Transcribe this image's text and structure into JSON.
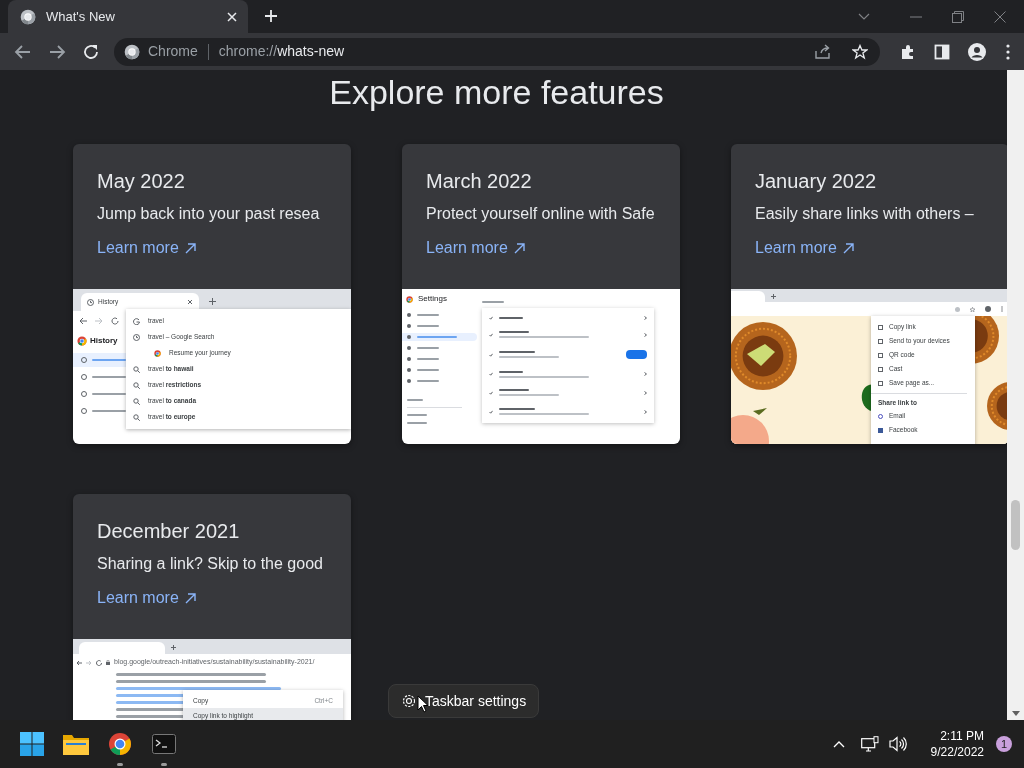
{
  "browser": {
    "tab": {
      "title": "What's New",
      "selected": true
    },
    "address": {
      "origin": "Chrome",
      "url_prefix": "chrome://",
      "url_path": "whats-new"
    }
  },
  "page": {
    "heading": "Explore more features",
    "cards": [
      {
        "month": "May 2022",
        "description": "Jump back into your past resea",
        "link": "Learn more",
        "thumbnail": {
          "kind": "history",
          "tab_title": "History",
          "page_title": "History",
          "suggestions": [
            {
              "kind": "google",
              "text": "travel"
            },
            {
              "kind": "history",
              "text": "travel – Google Search"
            },
            {
              "kind": "journey",
              "text": "Resume your journey"
            },
            {
              "kind": "search",
              "text": "travel **to hawaii**"
            },
            {
              "kind": "search",
              "text": "travel **restrictions**"
            },
            {
              "kind": "search",
              "text": "travel **to canada**"
            },
            {
              "kind": "search",
              "text": "travel **to europe**"
            }
          ]
        }
      },
      {
        "month": "March 2022",
        "description": "Protect yourself online with Safe",
        "link": "Learn more",
        "thumbnail": {
          "kind": "settings",
          "title": "Settings"
        }
      },
      {
        "month": "January 2022",
        "description": "Easily share links with others –",
        "link": "Learn more",
        "thumbnail": {
          "kind": "share",
          "menu": [
            "Copy link",
            "Send to your devices",
            "QR code",
            "Cast",
            "Save page as..."
          ],
          "share_heading": "Share link to",
          "share_targets": [
            "Email",
            "Facebook"
          ]
        }
      },
      {
        "month": "December 2021",
        "description": "Sharing a link? Skip to the good",
        "link": "Learn more",
        "thumbnail": {
          "kind": "highlight",
          "url": "blog.google/outreach-initiatives/sustainability/sustainability-2021/",
          "menu": [
            {
              "label": "Copy",
              "shortcut": "Ctrl+C",
              "hovered": false
            },
            {
              "label": "Copy link to highlight",
              "hovered": true
            }
          ]
        }
      }
    ]
  },
  "taskbar_menu": {
    "label": "Taskbar settings"
  },
  "taskbar": {
    "apps": [
      {
        "kind": "start",
        "running": false
      },
      {
        "kind": "folder",
        "running": false
      },
      {
        "kind": "chrome",
        "running": true
      },
      {
        "kind": "terminal",
        "running": true
      }
    ],
    "time": "2:11 PM",
    "date": "9/22/2022",
    "notifications": "1"
  }
}
